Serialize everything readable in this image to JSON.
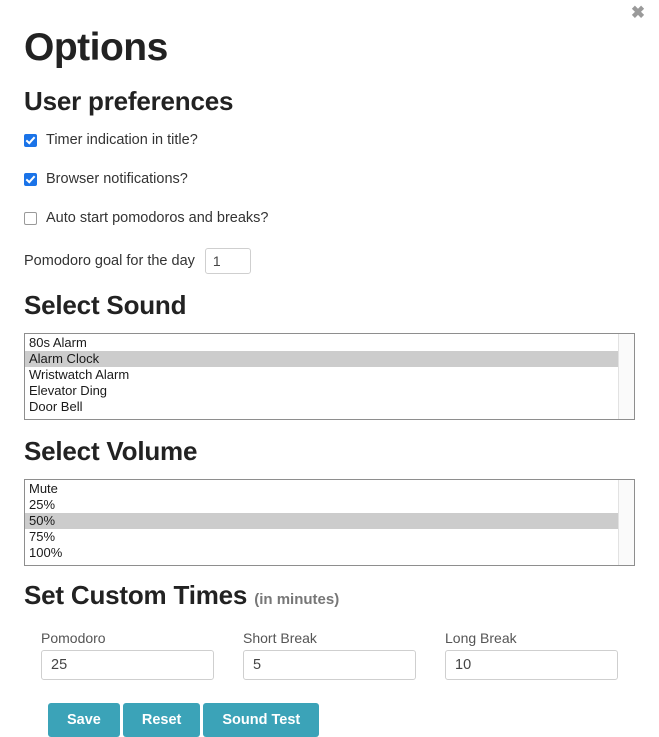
{
  "dialog": {
    "title": "Options",
    "close_label": "✖"
  },
  "user_preferences": {
    "heading": "User preferences",
    "checkboxes": [
      {
        "label": "Timer indication in title?",
        "checked": true
      },
      {
        "label": "Browser notifications?",
        "checked": true
      },
      {
        "label": "Auto start pomodoros and breaks?",
        "checked": false
      }
    ],
    "goal": {
      "label": "Pomodoro goal for the day",
      "value": "1"
    }
  },
  "select_sound": {
    "heading": "Select Sound",
    "options": [
      "80s Alarm",
      "Alarm Clock",
      "Wristwatch Alarm",
      "Elevator Ding",
      "Door Bell"
    ],
    "selected": "Alarm Clock"
  },
  "select_volume": {
    "heading": "Select Volume",
    "options": [
      "Mute",
      "25%",
      "50%",
      "75%",
      "100%"
    ],
    "selected": "50%"
  },
  "custom_times": {
    "heading": "Set Custom Times",
    "heading_suffix": "(in minutes)",
    "fields": [
      {
        "label": "Pomodoro",
        "value": "25"
      },
      {
        "label": "Short Break",
        "value": "5"
      },
      {
        "label": "Long Break",
        "value": "10"
      }
    ]
  },
  "actions": {
    "buttons": [
      {
        "label": "Save"
      },
      {
        "label": "Reset"
      },
      {
        "label": "Sound Test"
      }
    ]
  },
  "colors": {
    "button_teal": "#3ba3b8",
    "checkbox_blue": "#1a73e8",
    "selection_gray": "#cccccc"
  }
}
